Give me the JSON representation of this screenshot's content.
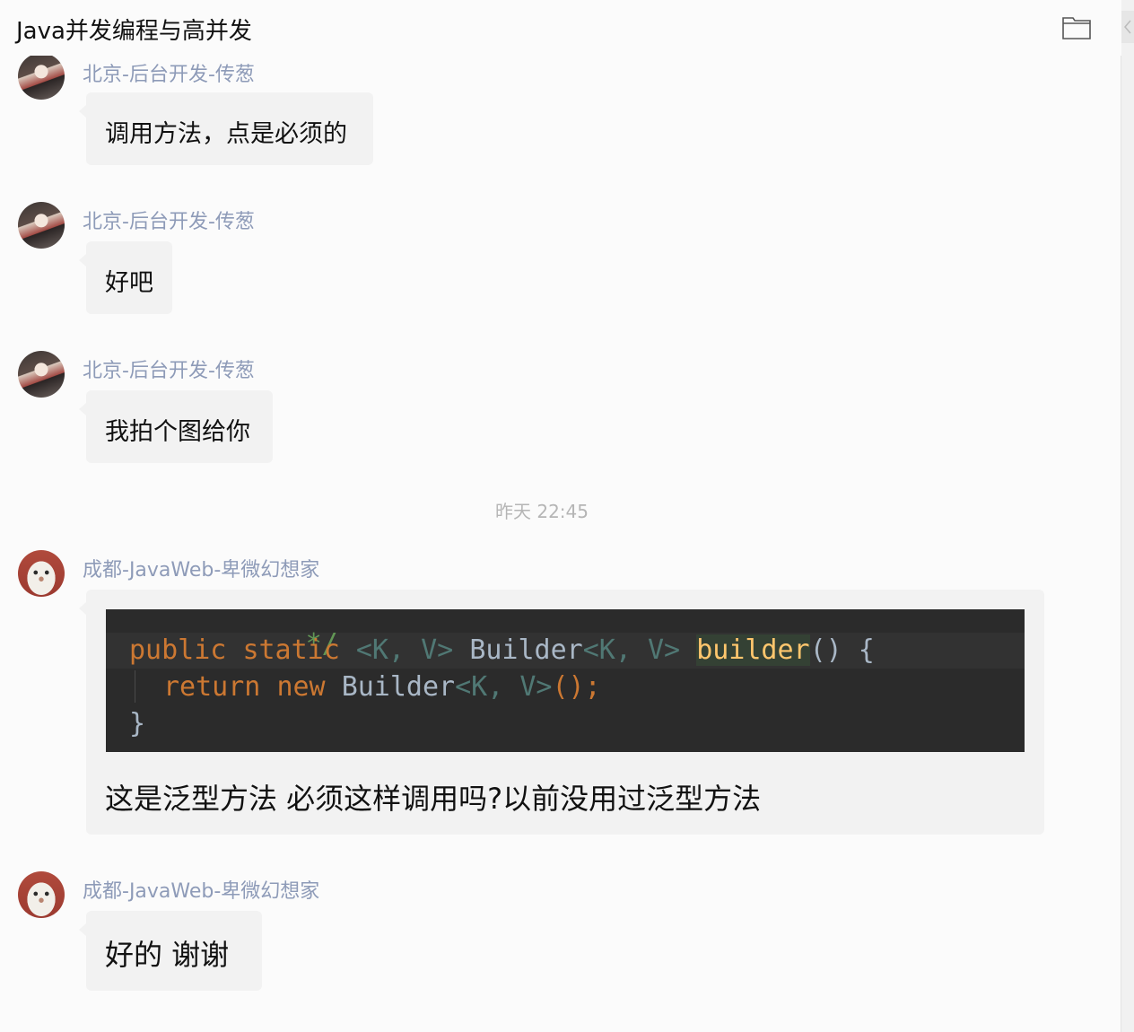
{
  "header": {
    "title": "Java并发编程与高并发",
    "folder_icon": "folder-icon"
  },
  "messages": [
    {
      "sender": "北京-后台开发-传葱",
      "text": "调用方法，点是必须的"
    },
    {
      "sender": "北京-后台开发-传葱",
      "text": "好吧"
    },
    {
      "sender": "北京-后台开发-传葱",
      "text": "我拍个图给你"
    },
    {
      "sender": "成都-JavaWeb-卑微幻想家",
      "text": "这是泛型方法  必须这样调用吗?以前没用过泛型方法"
    },
    {
      "sender": "成都-JavaWeb-卑微幻想家",
      "text": "好的  谢谢"
    }
  ],
  "timestamp": "昨天  22:45",
  "code_image": {
    "comment_fragment": "*/",
    "line1": {
      "kw1": "public",
      "kw2": "static",
      "gen_open": "<K, V>",
      "type1": "Builder",
      "gen2": "<K, V>",
      "fn": "builder",
      "tail": "() {"
    },
    "line2": {
      "kw1": "return",
      "kw2": "new",
      "type1": "Builder",
      "gen": "<K, V>",
      "tail": "();"
    },
    "line3": "}"
  },
  "colors": {
    "sender_name": "#8e9bb8",
    "bubble_bg": "#f2f2f2",
    "code_bg": "#2b2b2b",
    "keyword": "#cc7832",
    "function": "#ffc66d"
  }
}
